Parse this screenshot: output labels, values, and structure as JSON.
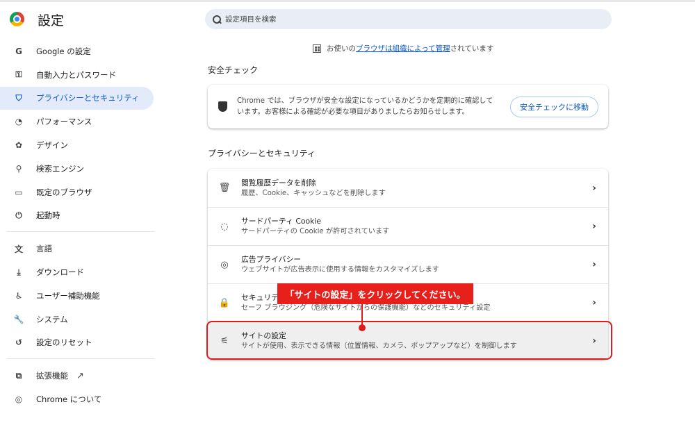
{
  "app": {
    "title": "設定"
  },
  "search": {
    "placeholder": "設定項目を検索"
  },
  "sidebar": {
    "items": [
      {
        "icon": "G",
        "label": "Google の設定"
      },
      {
        "icon": "⚿",
        "label": "自動入力とパスワード"
      },
      {
        "icon": "⛉",
        "label": "プライバシーとセキュリティ",
        "active": true
      },
      {
        "icon": "◔",
        "label": "パフォーマンス"
      },
      {
        "icon": "✿",
        "label": "デザイン"
      },
      {
        "icon": "⚲",
        "label": "検索エンジン"
      },
      {
        "icon": "▭",
        "label": "既定のブラウザ"
      },
      {
        "icon": "⏻",
        "label": "起動時"
      }
    ],
    "items2": [
      {
        "icon": "文",
        "label": "言語"
      },
      {
        "icon": "⤓",
        "label": "ダウンロード"
      },
      {
        "icon": "♿",
        "label": "ユーザー補助機能"
      },
      {
        "icon": "🔧",
        "label": "システム"
      },
      {
        "icon": "↺",
        "label": "設定のリセット"
      }
    ],
    "items3": [
      {
        "icon": "⧉",
        "label": "拡張機能"
      },
      {
        "icon": "◎",
        "label": "Chrome について"
      }
    ]
  },
  "managed": {
    "prefix": "お使いの",
    "link": "ブラウザは組織によって管理",
    "suffix": "されています"
  },
  "safety_check": {
    "section_title": "安全チェック",
    "text": "Chrome では、ブラウザが安全な設定になっているかどうかを定期的に確認しています。お客様による確認が必要な項目がありましたらお知らせします。",
    "button": "安全チェックに移動"
  },
  "privacy": {
    "section_title": "プライバシーとセキュリティ",
    "rows": [
      {
        "icon": "🗑",
        "title": "閲覧履歴データを削除",
        "subtitle": "履歴、Cookie、キャッシュなどを削除します"
      },
      {
        "icon": "◌",
        "title": "サードパーティ Cookie",
        "subtitle": "サードパーティの Cookie が許可されています"
      },
      {
        "icon": "◎",
        "title": "広告プライバシー",
        "subtitle": "ウェブサイトが広告表示に使用する情報をカスタマイズします"
      },
      {
        "icon": "🔒",
        "title": "セキュリティ",
        "subtitle": "セーフ ブラウジング（危険なサイトからの保護機能）などのセキュリティ設定"
      },
      {
        "icon": "⚟",
        "title": "サイトの設定",
        "subtitle": "サイトが使用、表示できる情報（位置情報、カメラ、ポップアップなど）を制御します"
      }
    ]
  },
  "annotation": {
    "callout": "「サイトの設定」をクリックしてください。"
  },
  "colors": {
    "accent": "#0b57d0",
    "highlight": "#e01b1b",
    "active_bg": "#e3ebfa"
  }
}
